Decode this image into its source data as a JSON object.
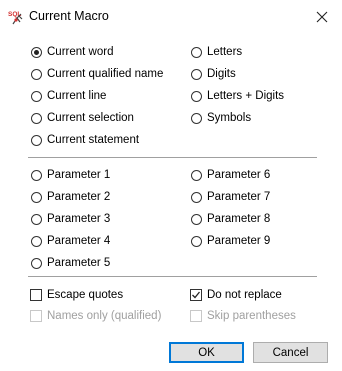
{
  "window": {
    "title": "Current Macro",
    "app_icon": "sql-icon"
  },
  "mode_options": [
    {
      "label": "Current word",
      "checked": true
    },
    {
      "label": "Current qualified name",
      "checked": false
    },
    {
      "label": "Current line",
      "checked": false
    },
    {
      "label": "Current selection",
      "checked": false
    },
    {
      "label": "Current statement",
      "checked": false
    }
  ],
  "char_options": [
    {
      "label": "Letters",
      "checked": false
    },
    {
      "label": "Digits",
      "checked": false
    },
    {
      "label": "Letters + Digits",
      "checked": false
    },
    {
      "label": "Symbols",
      "checked": false
    }
  ],
  "parameters_left": [
    "Parameter 1",
    "Parameter 2",
    "Parameter 3",
    "Parameter 4",
    "Parameter 5"
  ],
  "parameters_right": [
    "Parameter 6",
    "Parameter 7",
    "Parameter 8",
    "Parameter 9"
  ],
  "checkboxes": {
    "escape_quotes": {
      "label": "Escape quotes",
      "checked": false
    },
    "names_only": {
      "label": "Names only (qualified)",
      "checked": false,
      "disabled": true
    },
    "do_not_replace": {
      "label": "Do not replace",
      "checked": true
    },
    "skip_parentheses": {
      "label": "Skip parentheses",
      "checked": false,
      "disabled": true
    }
  },
  "buttons": {
    "ok": "OK",
    "cancel": "Cancel"
  }
}
